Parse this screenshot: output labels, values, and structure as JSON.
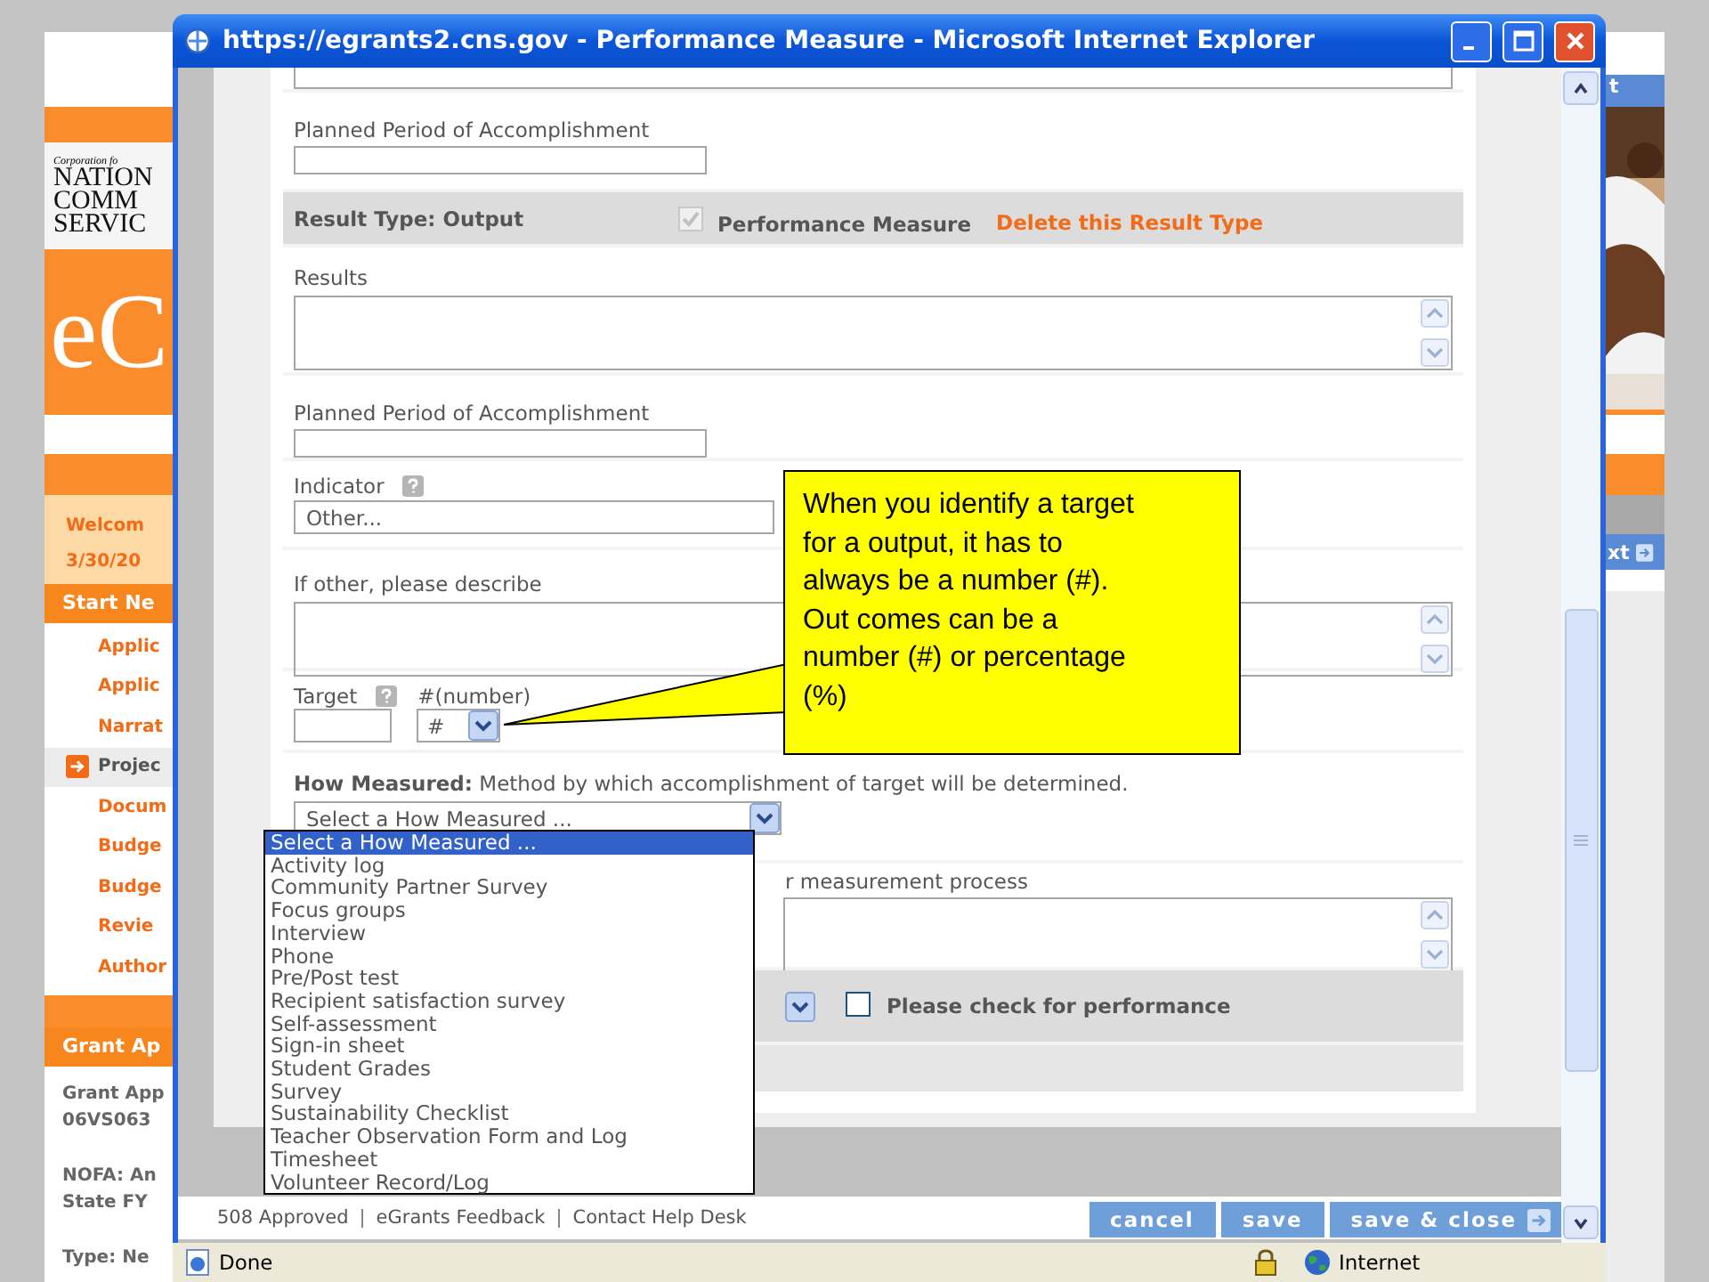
{
  "background_page": {
    "logo": {
      "tagline": "Corporation fo",
      "lines": [
        "NATION",
        "COMM",
        "SERVIC"
      ]
    },
    "brand": "eC",
    "welcome": "Welcom",
    "date": "3/30/20",
    "start_header": "Start Ne",
    "nav": [
      {
        "label": "Applic",
        "selected": false
      },
      {
        "label": "Applic",
        "selected": false
      },
      {
        "label": "Narrat",
        "selected": false
      },
      {
        "label": "Projec",
        "selected": true
      },
      {
        "label": "Docum",
        "selected": false
      },
      {
        "label": "Budge",
        "selected": false
      },
      {
        "label": "Budge",
        "selected": false
      },
      {
        "label": "Revie",
        "selected": false
      },
      {
        "label": "Author",
        "selected": false
      }
    ],
    "grant_header": "Grant Ap",
    "grant_info": [
      "Grant App",
      "06VS063"
    ],
    "nofa_info": [
      "NOFA: An",
      "State FY"
    ],
    "type_info": "Type: Ne",
    "right_header": "t",
    "right_button": "xt"
  },
  "browser_window": {
    "title": "https://egrants2.cns.gov - Performance Measure - Microsoft Internet Explorer",
    "status": "Done",
    "zone": "Internet"
  },
  "form": {
    "planned_period_1": {
      "label": "Planned Period of Accomplishment"
    },
    "result_type": {
      "title": "Result Type: Output",
      "performance_checked": true,
      "performance_disabled": true,
      "performance_label": "Performance Measure",
      "delete_link": "Delete this Result Type"
    },
    "results": {
      "label": "Results"
    },
    "planned_period_2": {
      "label": "Planned Period of Accomplishment"
    },
    "indicator": {
      "label": "Indicator",
      "value": "Other..."
    },
    "other_describe": {
      "label": "If other, please describe"
    },
    "target": {
      "label": "Target",
      "unit_label": "#(number)",
      "unit_value": "#"
    },
    "how_measured": {
      "label": "How Measured:",
      "description": "Method by which accomplishment of target will be determined.",
      "value": "Select a How Measured ...",
      "options": [
        {
          "label": "Select a How Measured ...",
          "selected": true
        },
        {
          "label": "Activity log",
          "selected": false
        },
        {
          "label": "Community Partner Survey",
          "selected": false
        },
        {
          "label": "Focus groups",
          "selected": false
        },
        {
          "label": "Interview",
          "selected": false
        },
        {
          "label": "Phone",
          "selected": false
        },
        {
          "label": "Pre/Post test",
          "selected": false
        },
        {
          "label": "Recipient satisfaction survey",
          "selected": false
        },
        {
          "label": "Self-assessment",
          "selected": false
        },
        {
          "label": "Sign-in sheet",
          "selected": false
        },
        {
          "label": "Student Grades",
          "selected": false
        },
        {
          "label": "Survey",
          "selected": false
        },
        {
          "label": "Sustainability Checklist",
          "selected": false
        },
        {
          "label": "Teacher Observation Form and Log",
          "selected": false
        },
        {
          "label": "Timesheet",
          "selected": false
        },
        {
          "label": "Volunteer Record/Log",
          "selected": false
        }
      ]
    },
    "process": {
      "label": "r measurement process"
    },
    "performance_check": {
      "checked": false,
      "label": "Please check for performance"
    }
  },
  "footer": {
    "links": [
      "508 Approved",
      "eGrants Feedback",
      "Contact Help Desk"
    ],
    "separator": "|",
    "buttons": [
      "cancel",
      "save",
      "save & close"
    ]
  },
  "callout": {
    "lines": [
      "When you identify a target",
      "for a output, it has to",
      "always be a number (#).",
      "Out comes can be a",
      "number (#) or percentage",
      "(%)"
    ]
  }
}
